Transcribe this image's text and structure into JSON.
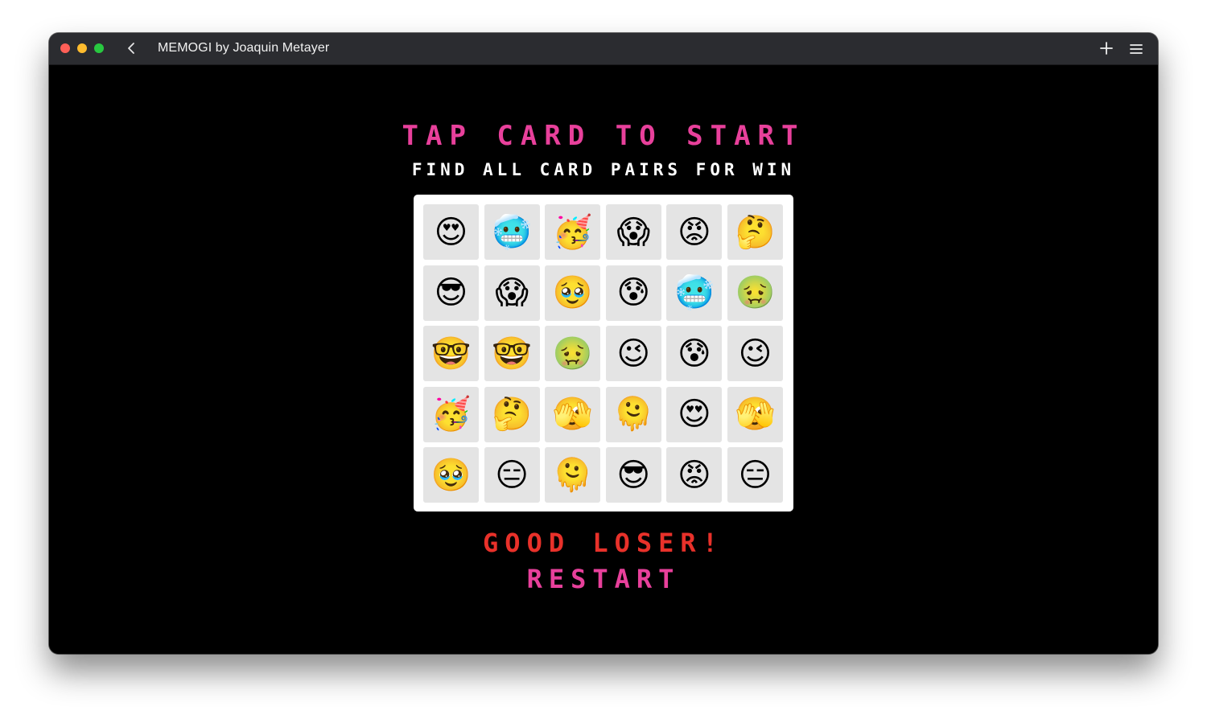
{
  "window": {
    "title": "MEMOGI by Joaquin Metayer"
  },
  "icons": {
    "back": "chevron-left-icon",
    "new_tab": "plus-icon",
    "menu": "hamburger-menu-icon"
  },
  "colors": {
    "headline": "#e8409b",
    "result": "#e8312a",
    "board": "#ffffff",
    "card": "#e4e4e4",
    "background": "#000000"
  },
  "game": {
    "headline": "TAP CARD TO START",
    "subline": "FIND ALL CARD PAIRS FOR WIN",
    "result": "GOOD LOSER!",
    "restart_label": "RESTART",
    "rows": [
      [
        "😍",
        "🥶",
        "🥳",
        "😱",
        "😡",
        "🤔"
      ],
      [
        "😎",
        "😱",
        "🥹",
        "😰",
        "🥶",
        "🤢"
      ],
      [
        "🤓",
        "🤓",
        "🤢",
        "😉",
        "😰",
        "😉"
      ],
      [
        "🥳",
        "🤔",
        "🫣",
        "🫠",
        "😍",
        "🫣"
      ],
      [
        "🥹",
        "😑",
        "🫠",
        "😎",
        "😡",
        "😑"
      ]
    ]
  }
}
